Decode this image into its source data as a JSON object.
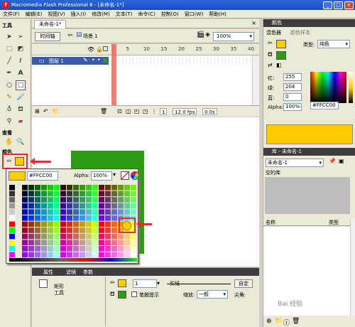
{
  "window": {
    "title": "Macromedia Flash Professional 8 - [未命名-1*]",
    "min": "_",
    "max": "□",
    "close": "×"
  },
  "menu": [
    "文件(F)",
    "编辑(E)",
    "视图(V)",
    "插入(I)",
    "修改(M)",
    "文本(T)",
    "命令(C)",
    "控制(O)",
    "窗口(W)",
    "帮助(H)"
  ],
  "tools": {
    "title": "工具",
    "view_label": "查看",
    "color_label": "颜色",
    "icons": [
      "selection-arrow",
      "subselection-arrow",
      "free-transform",
      "fill-transform",
      "line",
      "lasso",
      "pen",
      "text",
      "oval",
      "rectangle",
      "pencil",
      "brush",
      "ink-bottle",
      "paint-bucket",
      "eyedropper",
      "eraser",
      "hand",
      "zoom"
    ]
  },
  "document": {
    "tab": "未命名-1*",
    "close": "×",
    "timeline_button": "时间轴",
    "scene": "场景 1",
    "zoom": "100%"
  },
  "timeline": {
    "layer_name": "图层 1",
    "ruler_ticks": [
      "1",
      "5",
      "10",
      "15",
      "20",
      "25",
      "30",
      "35",
      "40"
    ],
    "current_frame": "1",
    "fps": "12.0 fps",
    "time": "0.0s"
  },
  "palette": {
    "hex": "#FFCC00",
    "alpha_label": "Alpha:",
    "alpha": "100%"
  },
  "color_panel": {
    "title": "颜色",
    "tab_mixer": "混色器",
    "tab_swatches": "颜色样本",
    "type_label": "类型:",
    "type_value": "纯色",
    "red_label": "红:",
    "red": "255",
    "green_label": "绿:",
    "green": "204",
    "blue_label": "蓝:",
    "blue": "0",
    "alpha_label": "Alpha:",
    "alpha": "100%",
    "hex": "#FFCC00"
  },
  "library": {
    "title": "库 - 未命名-1",
    "doc": "未命名-1",
    "empty": "空的库",
    "col_name": "名称",
    "col_type": "类型"
  },
  "properties": {
    "tab_props": "属性",
    "tab_filters": "滤镜",
    "tab_params": "参数",
    "tool_label": "矩形\n工具",
    "stroke_width": "1",
    "stroke_style": "实线",
    "custom": "自定",
    "hint": "笔触提示",
    "scale_label": "缩放:",
    "scale": "一般",
    "corner": "尖角:"
  },
  "colors": {
    "accent_yellow": "#FFCC00",
    "stage_green": "#2D9C13",
    "highlight_red": "#E03030"
  },
  "watermark": "Bai 经验"
}
